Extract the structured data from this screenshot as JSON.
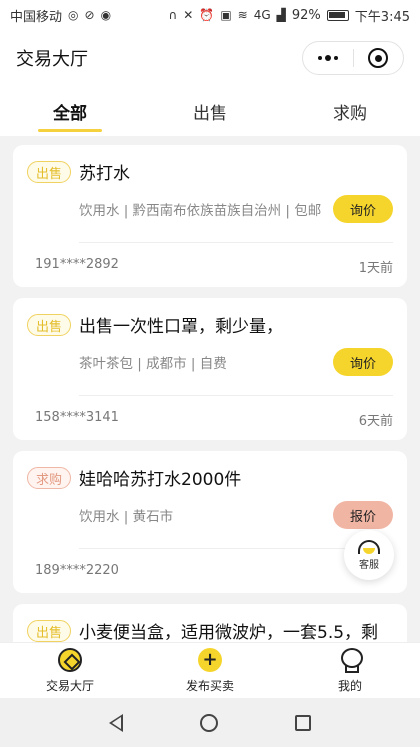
{
  "status_bar": {
    "carrier": "中国移动",
    "battery": "92%",
    "time": "下午3:45",
    "network": "4G"
  },
  "header": {
    "title": "交易大厅"
  },
  "tabs": [
    {
      "label": "全部"
    },
    {
      "label": "出售"
    },
    {
      "label": "求购"
    }
  ],
  "listings": [
    {
      "tag": "出售",
      "title": "苏打水",
      "detail": "饮用水 | 黔西南布依族苗族自治州 | 包邮",
      "action": "询价",
      "phone": "191****2892",
      "time": "1天前"
    },
    {
      "tag": "出售",
      "title": "出售一次性口罩，剩少量，",
      "detail": "茶叶茶包 | 成都市 | 自费",
      "action": "询价",
      "phone": "158****3141",
      "time": "6天前"
    },
    {
      "tag": "求购",
      "title": "娃哈哈苏打水2000件",
      "detail": "饮用水 | 黄石市",
      "action": "报价",
      "phone": "189****2220",
      "time": ""
    },
    {
      "tag": "出售",
      "title": "小麦便当盒，适用微波炉，一套5.5，剩"
    }
  ],
  "service": {
    "label": "客服"
  },
  "tabbar": [
    {
      "label": "交易大厅"
    },
    {
      "label": "发布买卖"
    },
    {
      "label": "我的"
    }
  ],
  "colors": {
    "accent": "#f5d52b",
    "buy_accent": "#f1b5a4"
  }
}
